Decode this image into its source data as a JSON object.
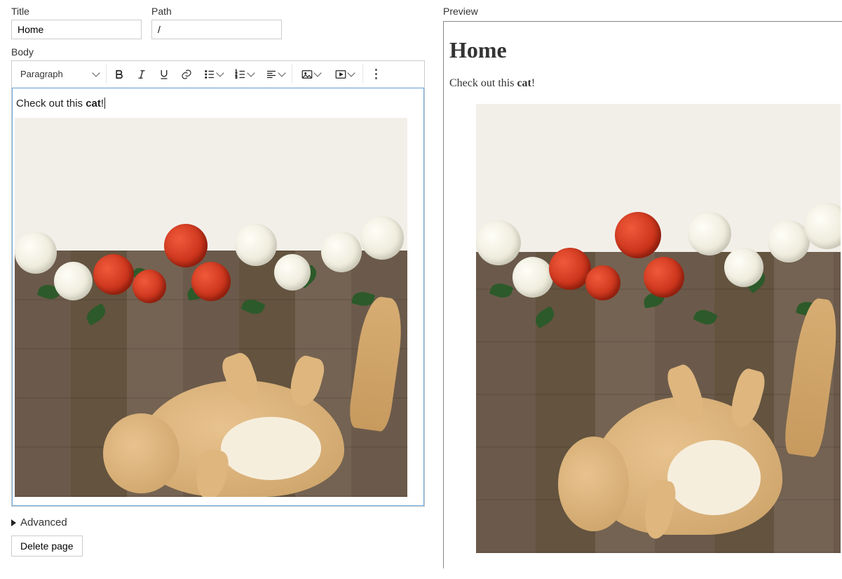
{
  "form": {
    "title_label": "Title",
    "title_value": "Home",
    "path_label": "Path",
    "path_value": "/",
    "body_label": "Body"
  },
  "toolbar": {
    "block_format": "Paragraph"
  },
  "content": {
    "line_prefix": "Check out this ",
    "line_bold": "cat",
    "line_suffix": "!"
  },
  "advanced": {
    "label": "Advanced"
  },
  "actions": {
    "delete": "Delete page"
  },
  "preview": {
    "label": "Preview",
    "heading": "Home",
    "line_prefix": "Check out this ",
    "line_bold": "cat",
    "line_suffix": "!"
  }
}
